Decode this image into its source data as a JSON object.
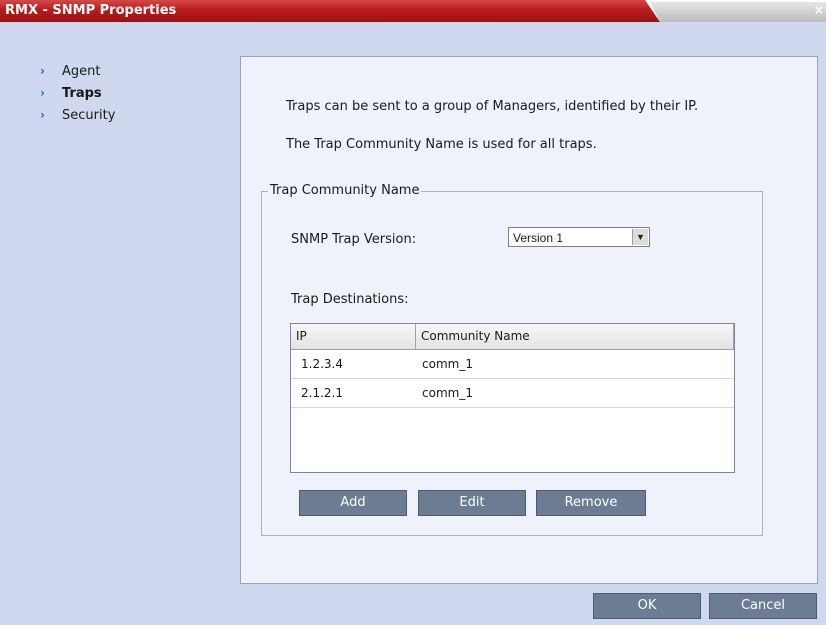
{
  "window": {
    "title": "RMX - SNMP Properties",
    "close_glyph": "×"
  },
  "nav": {
    "items": [
      {
        "label": "Agent",
        "active": false
      },
      {
        "label": "Traps",
        "active": true
      },
      {
        "label": "Security",
        "active": false
      }
    ],
    "chevron_glyph": "›"
  },
  "traps": {
    "intro_1": "Traps can be sent to a group of Managers, identified by their IP.",
    "intro_2": "The Trap Community Name is used for all traps.",
    "group_legend": "Trap Community Name",
    "version_label": "SNMP Trap Version:",
    "version_value": "Version 1",
    "destinations_label": "Trap Destinations:",
    "table": {
      "columns": [
        "IP",
        "Community Name"
      ],
      "rows": [
        [
          "1.2.3.4",
          "comm_1"
        ],
        [
          "2.1.2.1",
          "comm_1"
        ]
      ]
    },
    "buttons": {
      "add": "Add",
      "edit": "Edit",
      "remove": "Remove"
    }
  },
  "footer": {
    "ok": "OK",
    "cancel": "Cancel"
  },
  "colors": {
    "title_red": "#b71d1d",
    "background": "#cfd8ef",
    "panel": "#eff2fb",
    "button": "#6c7c93",
    "chevron": "#1a6fcf"
  }
}
